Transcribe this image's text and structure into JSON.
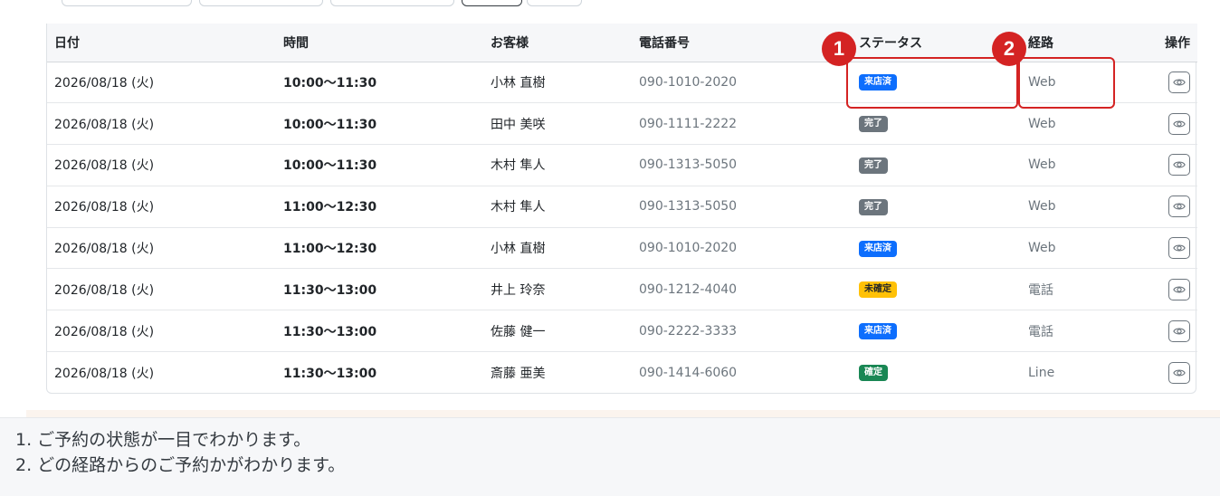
{
  "table": {
    "headers": {
      "date": "日付",
      "time": "時間",
      "customer": "お客様",
      "phone": "電話番号",
      "status": "ステータス",
      "route": "経路",
      "action": "操作"
    },
    "rows": [
      {
        "date": "2026/08/18 (火)",
        "time": "10:00〜11:30",
        "customer": "小林 直樹",
        "phone": "090-1010-2020",
        "status": "来店済",
        "status_kind": "visited",
        "route": "Web"
      },
      {
        "date": "2026/08/18 (火)",
        "time": "10:00〜11:30",
        "customer": "田中 美咲",
        "phone": "090-1111-2222",
        "status": "完了",
        "status_kind": "done",
        "route": "Web"
      },
      {
        "date": "2026/08/18 (火)",
        "time": "10:00〜11:30",
        "customer": "木村 隼人",
        "phone": "090-1313-5050",
        "status": "完了",
        "status_kind": "done",
        "route": "Web"
      },
      {
        "date": "2026/08/18 (火)",
        "time": "11:00〜12:30",
        "customer": "木村 隼人",
        "phone": "090-1313-5050",
        "status": "完了",
        "status_kind": "done",
        "route": "Web"
      },
      {
        "date": "2026/08/18 (火)",
        "time": "11:00〜12:30",
        "customer": "小林 直樹",
        "phone": "090-1010-2020",
        "status": "来店済",
        "status_kind": "visited",
        "route": "Web"
      },
      {
        "date": "2026/08/18 (火)",
        "time": "11:30〜13:00",
        "customer": "井上 玲奈",
        "phone": "090-1212-4040",
        "status": "未確定",
        "status_kind": "unconfirmed",
        "route": "電話"
      },
      {
        "date": "2026/08/18 (火)",
        "time": "11:30〜13:00",
        "customer": "佐藤 健一",
        "phone": "090-2222-3333",
        "status": "来店済",
        "status_kind": "visited",
        "route": "電話"
      },
      {
        "date": "2026/08/18 (火)",
        "time": "11:30〜13:00",
        "customer": "斎藤 亜美",
        "phone": "090-1414-6060",
        "status": "確定",
        "status_kind": "confirmed",
        "route": "Line"
      }
    ],
    "row_action_icon": "eye-icon"
  },
  "status_colors": {
    "visited": "#0d6efd",
    "done": "#6c757d",
    "unconfirmed": "#ffc107",
    "confirmed": "#198754"
  },
  "highlights": [
    {
      "number": "1",
      "target": "status"
    },
    {
      "number": "2",
      "target": "route"
    }
  ],
  "highlight_color": "#d42323",
  "captions": [
    "1. ご予約の状態が一目でわかります。",
    "2. どの経路からのご予約かがわかります。"
  ]
}
